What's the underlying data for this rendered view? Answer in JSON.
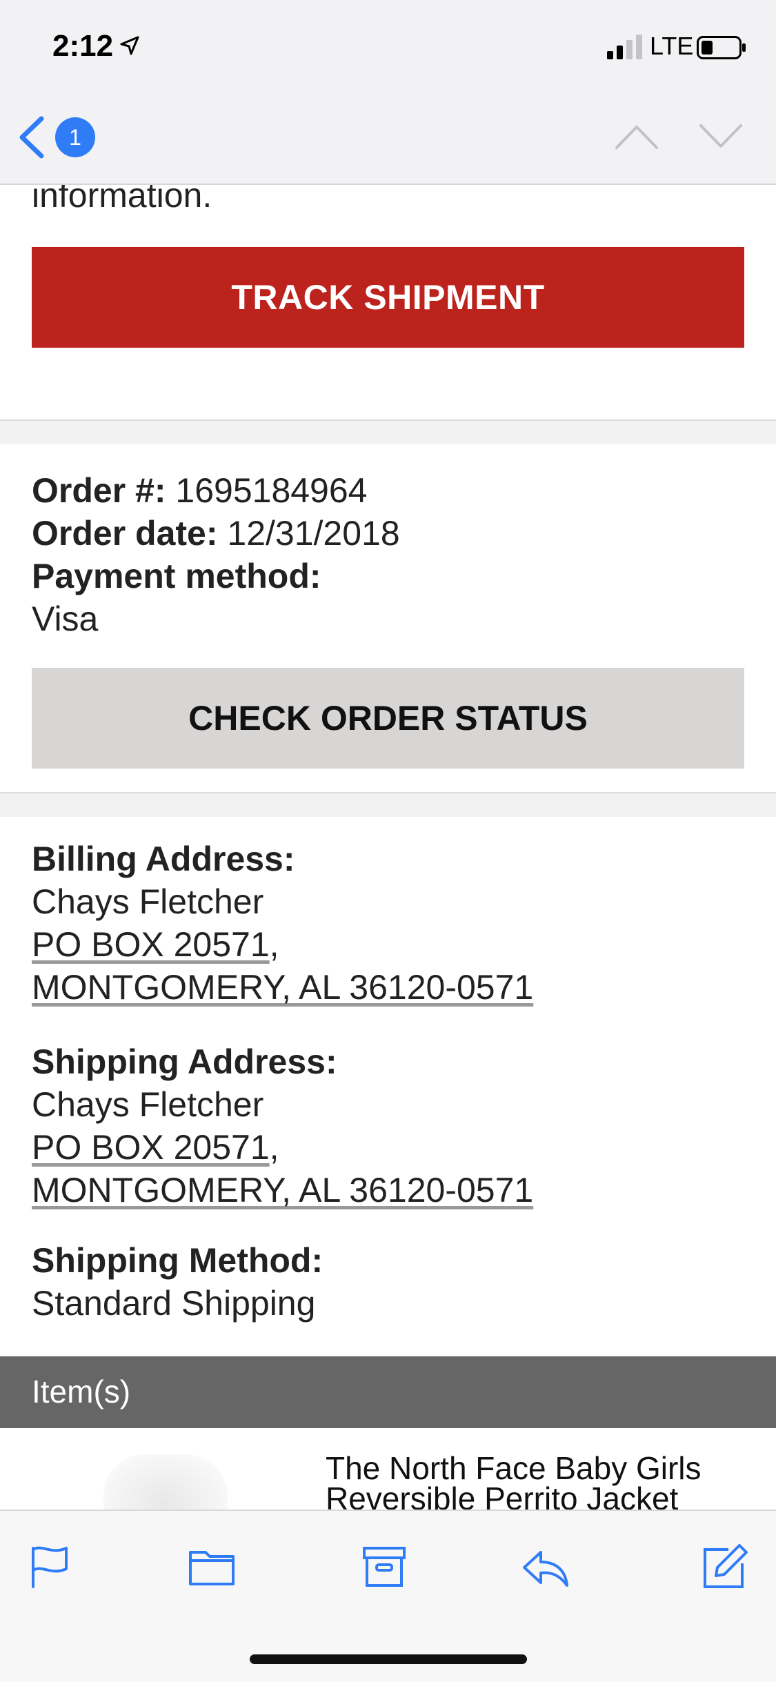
{
  "status_bar": {
    "time": "2:12",
    "network": "LTE"
  },
  "nav": {
    "back_badge": "1"
  },
  "content": {
    "partial_text": "information.",
    "track_button": "TRACK SHIPMENT",
    "order": {
      "number_label": "Order #:",
      "number_value": " 1695184964",
      "date_label": "Order date:",
      "date_value": " 12/31/2018",
      "payment_label": "Payment method:",
      "payment_value": "Visa"
    },
    "status_button": "CHECK ORDER STATUS",
    "billing": {
      "label": "Billing Address:",
      "name": "Chays Fletcher",
      "line1": "PO BOX 20571",
      "line1_suffix": ",",
      "line2": "MONTGOMERY, AL 36120-0571"
    },
    "shipping": {
      "label": "Shipping Address:",
      "name": "Chays Fletcher",
      "line1": "PO BOX 20571",
      "line1_suffix": ",",
      "line2": "MONTGOMERY, AL 36120-0571"
    },
    "method": {
      "label": "Shipping Method:",
      "value": "Standard Shipping"
    },
    "items_header": "Item(s)",
    "product_name": "The North Face Baby Girls Reversible Perrito Jacket"
  },
  "colors": {
    "accent_blue": "#2f7cf6",
    "track_red": "#bd231d",
    "status_gray": "#d8d5d5",
    "items_bar": "#666666"
  },
  "icons": {
    "toolbar": [
      "flag-icon",
      "folder-icon",
      "archive-icon",
      "reply-icon",
      "compose-icon"
    ]
  }
}
